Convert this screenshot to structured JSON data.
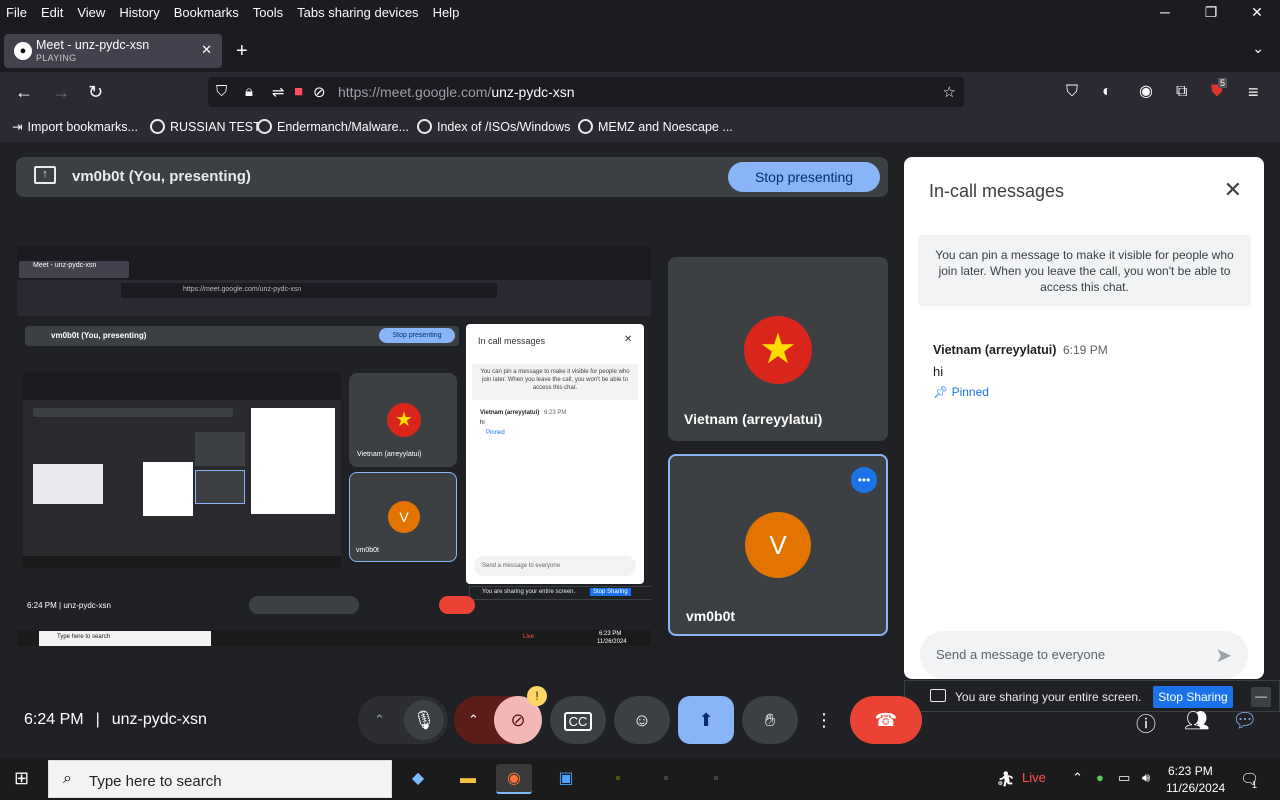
{
  "browser": {
    "menu": [
      "File",
      "Edit",
      "View",
      "History",
      "Bookmarks",
      "Tools",
      "Tabs sharing devices",
      "Help"
    ],
    "tab": {
      "title": "Meet - unz-pydc-xsn",
      "status": "PLAYING"
    },
    "url_host": "https://meet.google.com/",
    "url_path": "unz-pydc-xsn",
    "extension_badge": "5",
    "bookmarks": [
      "Import bookmarks...",
      "RUSSIAN TEST",
      "Endermanch/Malware...",
      "Index of /ISOs/Windows",
      "MEMZ and Noescape ..."
    ]
  },
  "meet": {
    "presenting_label": "vm0b0t (You, presenting)",
    "stop_presenting": "Stop presenting",
    "tiles": [
      {
        "name": "Vietnam (arreyylatui)",
        "avatar": "★"
      },
      {
        "name": "vm0b0t",
        "avatar": "V"
      }
    ],
    "chat": {
      "title": "In-call messages",
      "note": "You can pin a message to make it visible for people who join later. When you leave the call, you won't be able to access this chat.",
      "sender": "Vietnam (arreyylatui)",
      "time": "6:19 PM",
      "message": "hi",
      "pinned": "Pinned",
      "input_placeholder": "Send a message to everyone"
    },
    "share_bar": {
      "text": "You are sharing your entire screen.",
      "button": "Stop Sharing"
    },
    "meeting_time": "6:24 PM",
    "meeting_code": "unz-pydc-xsn"
  },
  "mirror": {
    "tab_title": "Meet - unz-pydc-xsn",
    "url": "https://meet.google.com/unz-pydc-xsn",
    "presenting_label": "vm0b0t (You, presenting)",
    "stop": "Stop presenting",
    "chat_title": "In call messages",
    "note": "You can pin a message to make it visible for people who join later. When you leave the call, you won't be able to access this chat.",
    "sender": "Vietnam (arreyylatui)",
    "time": "6:23 PM",
    "message": "hi",
    "pinned": "Pinned",
    "input": "Send a message to everyone",
    "share_text": "You are sharing your entire screen.",
    "share_btn": "Stop Sharing",
    "tile1": "Vietnam (arreyylatui)",
    "tile2": "vm0b0t",
    "clock": "6:24 PM | unz-pydc-xsn",
    "taskbar_search": "Type here to search",
    "live": "Live",
    "date": "11/26/2024"
  },
  "taskbar": {
    "search": "Type here to search",
    "live": "Live",
    "time": "6:23 PM",
    "date": "11/26/2024",
    "notif": "1"
  },
  "colors": {
    "meet_bg": "#202124",
    "accent": "#8ab4f8",
    "end_call": "#ea4335",
    "avatar_orange": "#e37400",
    "flag_red": "#da251d"
  }
}
